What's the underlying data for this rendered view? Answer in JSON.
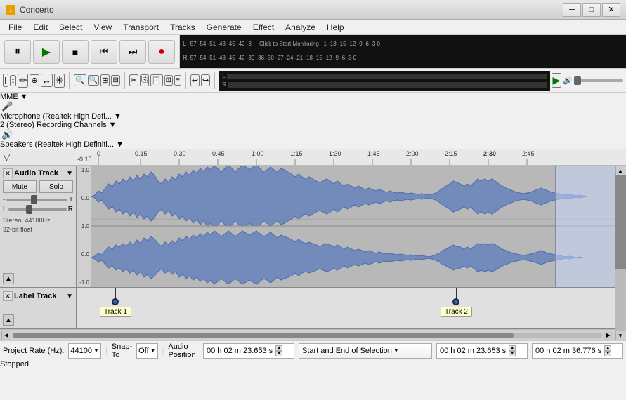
{
  "app": {
    "title": "Concerto",
    "icon": "♪"
  },
  "titlebar": {
    "minimize": "─",
    "maximize": "□",
    "close": "✕"
  },
  "menu": {
    "items": [
      "File",
      "Edit",
      "Select",
      "View",
      "Transport",
      "Tracks",
      "Generate",
      "Effect",
      "Analyze",
      "Help"
    ]
  },
  "transport": {
    "pause": "⏸",
    "play": "▶",
    "stop": "■",
    "skip_back": "⏮",
    "skip_fwd": "⏭",
    "record": "●"
  },
  "tools": {
    "select": "I",
    "envelope": "↕",
    "draw": "✏",
    "zoom": "🔍",
    "timeshift": "↔",
    "multi": "✳"
  },
  "devices": {
    "api": "MME",
    "mic": "Microphone (Realtek High Defi...",
    "channels": "2 (Stereo) Recording Channels",
    "speaker_icon": "🔊",
    "output": "Speakers (Realtek High Definiti..."
  },
  "timeline": {
    "markers": [
      "-0.15",
      "0",
      "0.15",
      "0.30",
      "0.45",
      "1:00",
      "1:15",
      "1:30",
      "1:45",
      "2:00",
      "2:15",
      "2:30",
      "2:45"
    ]
  },
  "audio_track": {
    "name": "Audio Track",
    "mute": "Mute",
    "solo": "Solo",
    "gain_min": "-",
    "gain_max": "+",
    "pan_left": "L",
    "pan_right": "R",
    "info": "Stereo, 44100Hz\n32-bit float",
    "scale_top": "1.0",
    "scale_mid": "0.0",
    "scale_bot": "-1.0"
  },
  "label_track": {
    "name": "Label Track",
    "track1": "Track 1",
    "track2": "Track 2"
  },
  "bottom": {
    "project_rate_label": "Project Rate (Hz):",
    "project_rate": "44100",
    "snap_to_label": "Snap-To",
    "snap_off": "Off",
    "audio_pos_label": "Audio Position",
    "audio_pos": "0 0 h 0 2 m 2 3 . 6 5 3 s",
    "audio_pos_val": "00 h 02 m 23.653 s",
    "selection_label": "Start and End of Selection",
    "sel_start": "00 h 02 m 23.653 s",
    "sel_end": "00 h 02 m 36.776 s"
  },
  "status": {
    "text": "Stopped."
  },
  "meter": {
    "numbers_top": [
      "-57",
      "-54",
      "-51",
      "-48",
      "-45",
      "-42",
      "-3",
      "Click to Start Monitoring",
      "1",
      "-18",
      "-15",
      "-12",
      "-9",
      "-6",
      "-3",
      "0"
    ],
    "numbers_bot": [
      "-57",
      "-54",
      "-51",
      "-48",
      "-45",
      "-42",
      "-39",
      "-36",
      "-30",
      "-27",
      "-24",
      "-21",
      "-18",
      "-15",
      "-12",
      "-9",
      "-6",
      "-3",
      "0"
    ]
  }
}
